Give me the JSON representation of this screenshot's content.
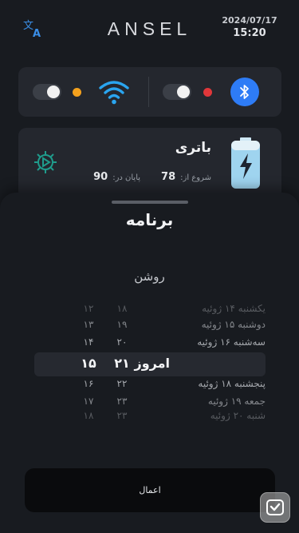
{
  "header": {
    "logo": "ANSEL",
    "date": "2024/07/17",
    "time": "15:20"
  },
  "connections": {
    "wifi": {
      "enabled": true,
      "status_color": "#f4a11d"
    },
    "bluetooth": {
      "enabled": true,
      "status_color": "#e0373a"
    }
  },
  "battery": {
    "title": "باتری",
    "start_label": "شروع از:",
    "start_value": "78",
    "end_label": "پایان در:",
    "end_value": "90"
  },
  "schedule": {
    "title": "برنامه",
    "mode": "روشن",
    "rows": [
      {
        "day": "یکشنبه ۱۴ ژوئیه",
        "hour": "۱۸",
        "minute": "۱۲",
        "opacity": 0.35
      },
      {
        "day": "دوشنبه ۱۵ ژوئیه",
        "hour": "۱۹",
        "minute": "۱۳",
        "opacity": 0.6
      },
      {
        "day": "سه‌شنبه ۱۶ ژوئیه",
        "hour": "۲۰",
        "minute": "۱۴",
        "opacity": 0.8
      },
      {
        "day": "امروز",
        "hour": "۲۱",
        "minute": "۱۵",
        "opacity": 1,
        "selected": true
      },
      {
        "day": "پنجشنبه ۱۸ ژوئیه",
        "hour": "۲۲",
        "minute": "۱۶",
        "opacity": 0.8
      },
      {
        "day": "جمعه ۱۹ ژوئیه",
        "hour": "۲۳",
        "minute": "۱۷",
        "opacity": 0.6
      },
      {
        "day": "شنبه ۲۰ ژوئیه",
        "hour": "۲۳",
        "minute": "۱۸",
        "opacity": 0.35
      }
    ],
    "apply_label": "اعمال"
  },
  "colors": {
    "accent_blue": "#2e7cf6",
    "wifi_blue": "#2aa5f0",
    "gear_teal": "#1f9c8c",
    "battery_blue": "#9fd4ef"
  }
}
